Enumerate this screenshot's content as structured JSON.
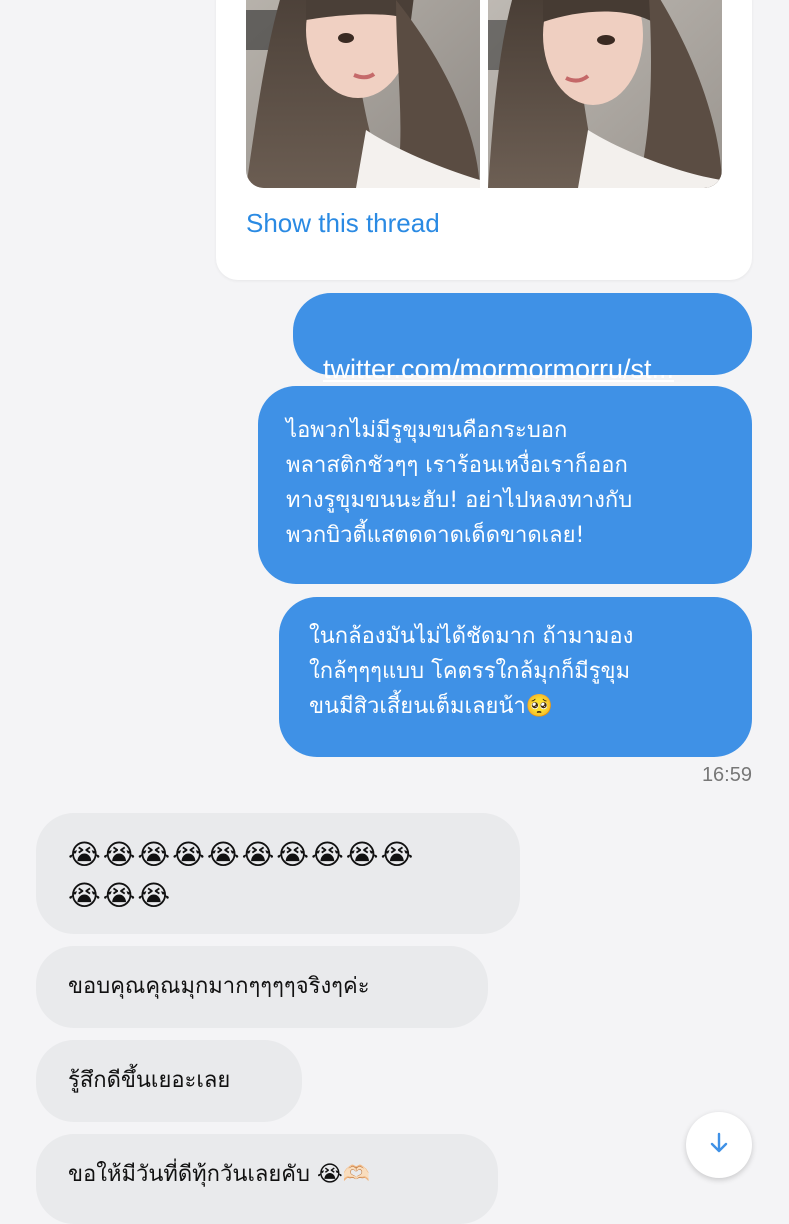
{
  "tweet_card": {
    "show_thread": "Show this thread"
  },
  "messages": {
    "link": "twitter.com/mormormorru/st...",
    "msg1": "ไอพวกไม่มีรูขุมขนคือกระบอก\nพลาสติกชัวๆๆ เราร้อนเหงื่อเราก็ออก\nทางรูขุมขนนะฮับ! อย่าไปหลงทางกับ\nพวกบิวตี้แสตดดาดเด็ดขาดเลย!",
    "msg2": "ในกล้องมันไม่ได้ชัดมาก ถ้ามามอง\nใกล้ๆๆๆแบบ โคตรรใกล้มุกก็มีรูขุม\nขนมีสิวเสี้ยนเต็มเลยน้า🥺",
    "timestamp": "16:59",
    "cry": "😭😭😭😭😭😭😭😭😭😭\n😭😭😭",
    "thanks": "ขอบคุณคุณมุกมากๆๆๆๆจริงๆค่ะ",
    "feel": "รู้สึกดีขึ้นเยอะเลย",
    "wish": "ขอให้มีวันที่ดีทุ้กวันเลยคับ 😭🫶🏻"
  },
  "colors": {
    "accent": "#3f91e6",
    "link": "#2a8ae3",
    "incoming_bubble": "#e9eaec",
    "background": "#f4f4f6"
  },
  "icons": {
    "scroll_down": "arrow-down-icon"
  }
}
